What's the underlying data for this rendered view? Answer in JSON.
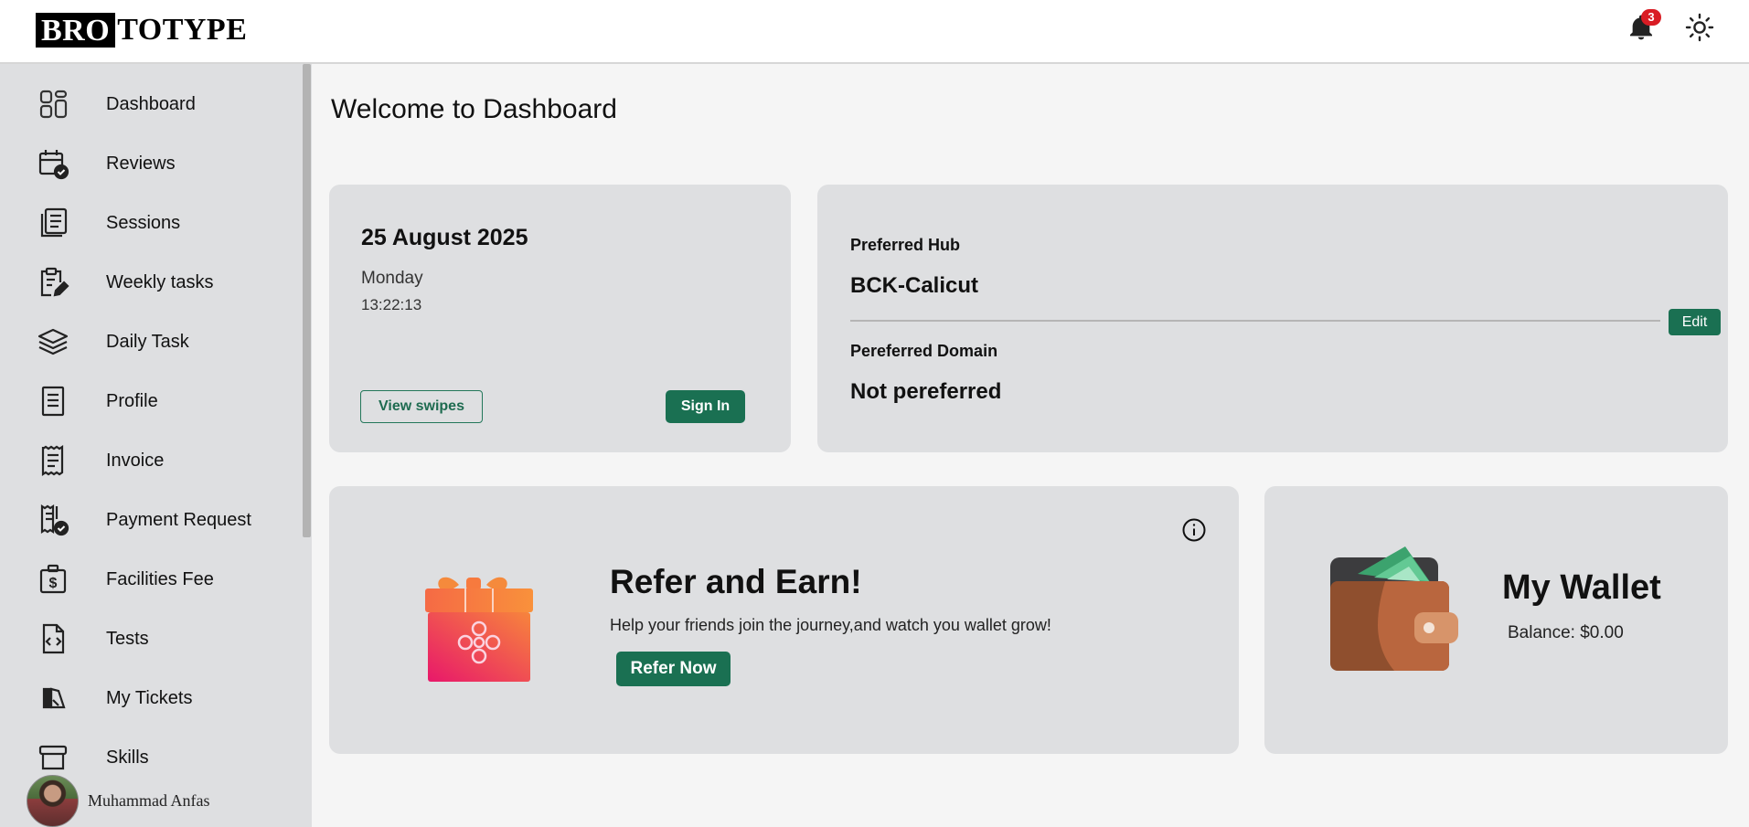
{
  "header": {
    "logo_boxed": "BRO",
    "logo_rest": "TOTYPE",
    "notification_count": "3",
    "icons": [
      "bell-icon",
      "sun-icon"
    ]
  },
  "sidebar": {
    "items": [
      {
        "label": "Dashboard",
        "icon": "dashboard-icon"
      },
      {
        "label": "Reviews",
        "icon": "calendar-check-icon"
      },
      {
        "label": "Sessions",
        "icon": "sessions-icon"
      },
      {
        "label": "Weekly tasks",
        "icon": "clipboard-edit-icon"
      },
      {
        "label": "Daily Task",
        "icon": "layers-icon"
      },
      {
        "label": "Profile",
        "icon": "document-icon"
      },
      {
        "label": "Invoice",
        "icon": "receipt-icon"
      },
      {
        "label": "Payment Request",
        "icon": "receipt-check-icon"
      },
      {
        "label": "Facilities Fee",
        "icon": "fee-icon"
      },
      {
        "label": "Tests",
        "icon": "code-file-icon"
      },
      {
        "label": "My Tickets",
        "icon": "tickets-icon"
      },
      {
        "label": "Skills",
        "icon": "archive-icon"
      }
    ],
    "user_name": "Muhammad Anfas"
  },
  "main": {
    "title": "Welcome to Dashboard",
    "date_card": {
      "date": "25 August 2025",
      "day": "Monday",
      "time": "13:22:13",
      "view_swipes_label": "View swipes",
      "sign_in_label": "Sign In"
    },
    "hub_card": {
      "hub_label": "Preferred Hub",
      "hub_value": "BCK-Calicut",
      "domain_label": "Pereferred Domain",
      "domain_value": "Not pereferred",
      "edit_label": "Edit"
    },
    "refer_card": {
      "title": "Refer and Earn!",
      "subtitle": "Help your friends join the journey,and watch you wallet grow!",
      "button_label": "Refer Now"
    },
    "wallet_card": {
      "title": "My Wallet",
      "balance": "Balance: $0.00"
    }
  },
  "colors": {
    "accent_green": "#1a7052",
    "card_bg": "#dedfe1",
    "badge_red": "#d91c24"
  }
}
